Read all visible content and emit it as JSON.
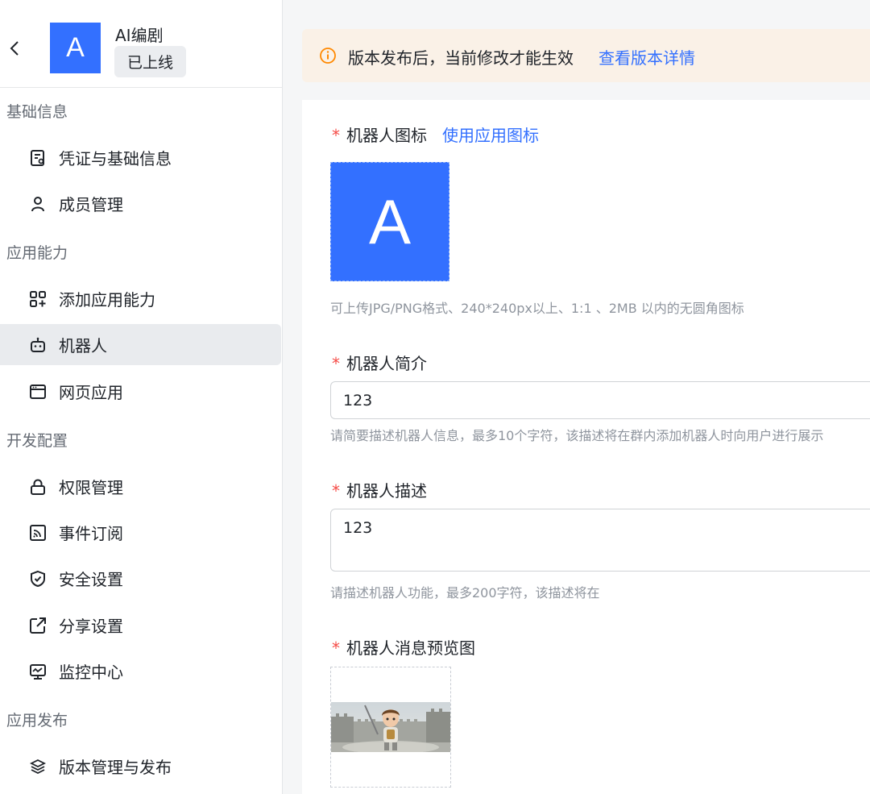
{
  "app": {
    "avatar_letter": "A",
    "name": "AI编剧",
    "status": "已上线",
    "brand_color": "#3370ff"
  },
  "sidebar": {
    "sections": [
      {
        "title": "基础信息",
        "items": [
          {
            "label": "凭证与基础信息",
            "icon": "credential-icon"
          },
          {
            "label": "成员管理",
            "icon": "member-icon"
          }
        ]
      },
      {
        "title": "应用能力",
        "items": [
          {
            "label": "添加应用能力",
            "icon": "add-capability-icon"
          },
          {
            "label": "机器人",
            "icon": "robot-icon",
            "active": true
          },
          {
            "label": "网页应用",
            "icon": "web-app-icon"
          }
        ]
      },
      {
        "title": "开发配置",
        "items": [
          {
            "label": "权限管理",
            "icon": "lock-icon"
          },
          {
            "label": "事件订阅",
            "icon": "rss-icon"
          },
          {
            "label": "安全设置",
            "icon": "shield-icon"
          },
          {
            "label": "分享设置",
            "icon": "share-icon"
          },
          {
            "label": "监控中心",
            "icon": "monitor-icon"
          }
        ]
      },
      {
        "title": "应用发布",
        "items": [
          {
            "label": "版本管理与发布",
            "icon": "layers-icon"
          }
        ]
      }
    ]
  },
  "banner": {
    "text": "版本发布后，当前修改才能生效",
    "link": "查看版本详情",
    "icon": "info-icon",
    "bg_color": "#faf1e7",
    "icon_color": "#ff8800"
  },
  "form": {
    "required_mark": "*",
    "bot_icon": {
      "label": "机器人图标",
      "link": "使用应用图标",
      "preview_letter": "A",
      "hint": "可上传JPG/PNG格式、240*240px以上、1:1 、2MB 以内的无圆角图标"
    },
    "bot_intro": {
      "label": "机器人简介",
      "value": "123",
      "hint": "请简要描述机器人信息，最多10个字符，该描述将在群内添加机器人时向用户进行展示"
    },
    "bot_desc": {
      "label": "机器人描述",
      "value": "123",
      "hint": "请描述机器人功能，最多200字符，该描述将在"
    },
    "bot_preview": {
      "label": "机器人消息预览图",
      "image": "knight-character-castle-image"
    }
  }
}
